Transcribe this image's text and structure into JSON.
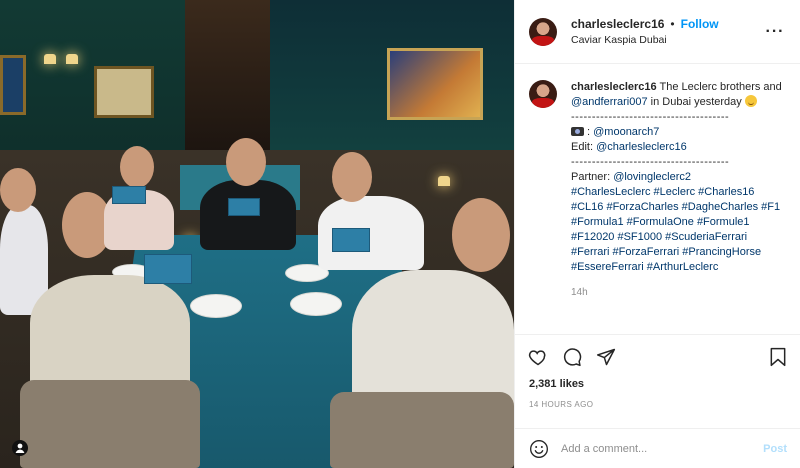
{
  "post": {
    "username": "charlesleclerc16",
    "follow_label": "Follow",
    "location": "Caviar Kaspia Dubai",
    "photo_alt": "Dinner table photo",
    "more_icon": "more-options-icon"
  },
  "caption": {
    "line1_text": " The Leclerc brothers and ",
    "mention_andf": "@andferrari007",
    "line1_after": " in Dubai yesterday ",
    "rule": "--------------------------------------",
    "photo_credit": "@moonarch7",
    "edit_prefix": "Edit: ",
    "edit_mention": "@charlesleclerc16",
    "partner_prefix": "Partner: ",
    "partner_mention": "@lovingleclerc2",
    "hashtags": "#CharlesLeclerc #Leclerc #Charles16 #CL16 #ForzaCharles #DagheCharles #F1 #Formula1 #FormulaOne #Formule1 #F12020 #SF1000 #ScuderiaFerrari #Ferrari #ForzaFerrari #PrancingHorse #EssereFerrari #ArthurLeclerc",
    "time": "14h"
  },
  "actions": {
    "likes": "2,381 likes",
    "ago": "14 HOURS AGO"
  },
  "comment": {
    "placeholder": "Add a comment...",
    "post_label": "Post"
  },
  "colors": {
    "follow": "#0095f6",
    "link": "#00376b",
    "muted": "#8e8e8e"
  }
}
